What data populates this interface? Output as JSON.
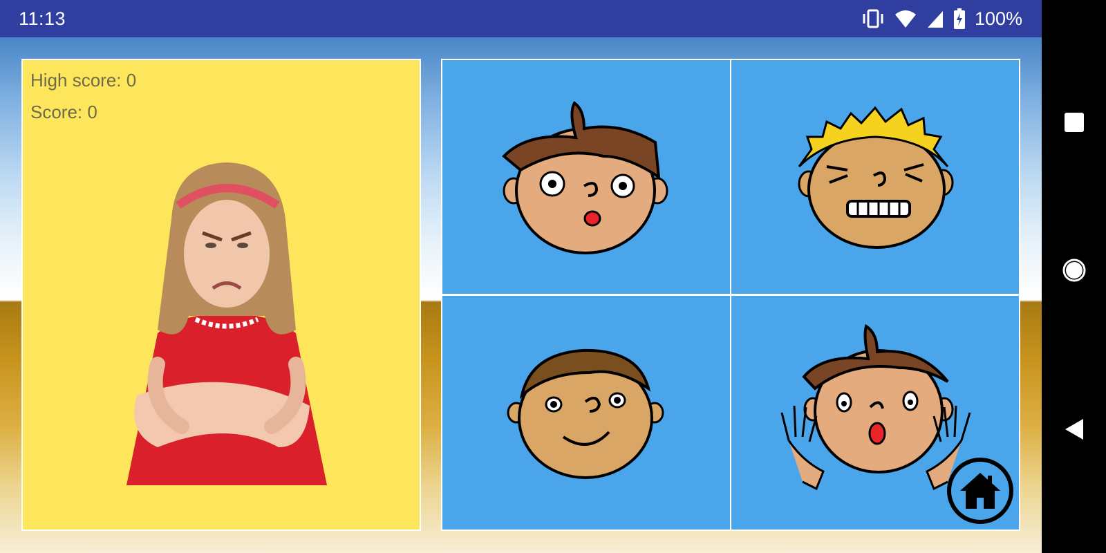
{
  "status_bar": {
    "time": "11:13",
    "battery": "100%",
    "icons": [
      "vibrate-icon",
      "wifi-icon",
      "signal-icon",
      "battery-charging-icon"
    ]
  },
  "game": {
    "high_score_label": "High score: 0",
    "score_label": "Score: 0",
    "prompt_image": "angry-girl-photo",
    "choices": [
      {
        "face": "surprised-face"
      },
      {
        "face": "angry-face"
      },
      {
        "face": "happy-face"
      },
      {
        "face": "shocked-face"
      }
    ]
  },
  "nav": {
    "recents": "square-icon",
    "home": "circle-icon",
    "back": "triangle-back-icon"
  },
  "colors": {
    "status_bar": "#303f9f",
    "card": "#fde65c",
    "tile": "#4aa5ea"
  }
}
